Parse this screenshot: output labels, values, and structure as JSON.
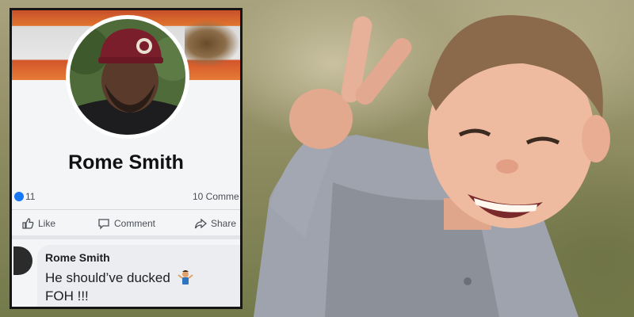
{
  "profile": {
    "name": "Rome Smith"
  },
  "reactions": {
    "count": "11",
    "comments": "10 Comme"
  },
  "actions": {
    "like": "Like",
    "comment": "Comment",
    "share": "Share"
  },
  "comment": {
    "author": "Rome Smith",
    "line1": "He should’ve ducked",
    "line2": "FOH !!!"
  },
  "icons": [
    "like-icon",
    "comment-icon",
    "share-icon",
    "shrug-emoji-icon"
  ],
  "colors": {
    "facebook_blue": "#1877f2",
    "cover_orange": "#e0742e",
    "cap_maroon": "#7b1e2b"
  }
}
